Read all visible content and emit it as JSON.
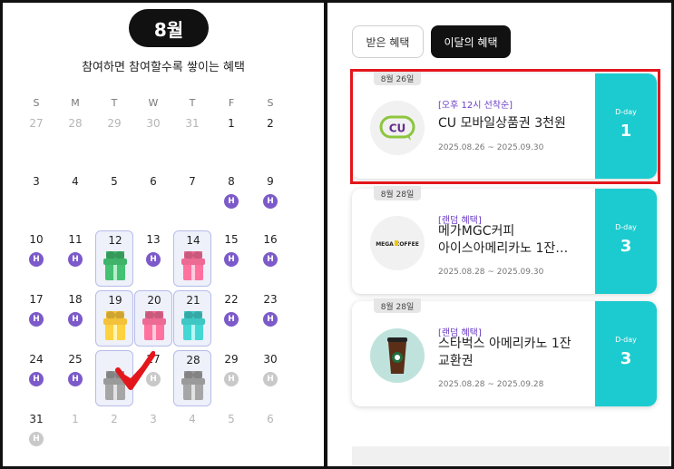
{
  "calendar": {
    "month": "8월",
    "subtitle": "참여하면 참여할수록 쌓이는 혜택",
    "weekdays": [
      "S",
      "M",
      "T",
      "W",
      "T",
      "F",
      "S"
    ],
    "badge_label": "H",
    "days": [
      {
        "n": "27",
        "other": true
      },
      {
        "n": "28",
        "other": true
      },
      {
        "n": "29",
        "other": true
      },
      {
        "n": "30",
        "other": true
      },
      {
        "n": "31",
        "other": true
      },
      {
        "n": "1"
      },
      {
        "n": "2"
      },
      {
        "n": "3"
      },
      {
        "n": "4"
      },
      {
        "n": "5"
      },
      {
        "n": "6"
      },
      {
        "n": "7"
      },
      {
        "n": "8",
        "badge": "purple"
      },
      {
        "n": "9",
        "badge": "purple"
      },
      {
        "n": "10",
        "badge": "purple"
      },
      {
        "n": "11",
        "badge": "purple"
      },
      {
        "n": "12",
        "gift": "green",
        "boxed": true
      },
      {
        "n": "13",
        "badge": "purple"
      },
      {
        "n": "14",
        "gift": "pink",
        "boxed": true
      },
      {
        "n": "15",
        "badge": "purple"
      },
      {
        "n": "16",
        "badge": "purple"
      },
      {
        "n": "17",
        "badge": "purple"
      },
      {
        "n": "18",
        "badge": "purple"
      },
      {
        "n": "19",
        "gift": "yellow",
        "boxed": true
      },
      {
        "n": "20",
        "gift": "pink",
        "boxed": true
      },
      {
        "n": "21",
        "gift": "teal",
        "boxed": true
      },
      {
        "n": "22",
        "badge": "purple"
      },
      {
        "n": "23",
        "badge": "purple"
      },
      {
        "n": "24",
        "badge": "purple"
      },
      {
        "n": "25",
        "badge": "purple"
      },
      {
        "n": "",
        "gift": "gray",
        "boxed": true,
        "checked": true
      },
      {
        "n": "27",
        "badge": "gray"
      },
      {
        "n": "28",
        "gift": "gray",
        "boxed": true
      },
      {
        "n": "29",
        "badge": "gray"
      },
      {
        "n": "30",
        "badge": "gray"
      },
      {
        "n": "31",
        "badge": "gray"
      },
      {
        "n": "1",
        "other": true
      },
      {
        "n": "2",
        "other": true
      },
      {
        "n": "3",
        "other": true
      },
      {
        "n": "4",
        "other": true
      },
      {
        "n": "5",
        "other": true
      },
      {
        "n": "6",
        "other": true
      }
    ],
    "colors": {
      "purple": "#7c5ac9",
      "gift_green": "#3fb36a",
      "gift_pink": "#ec6a93",
      "gift_yellow": "#f3c23a",
      "gift_teal": "#3fc7c4",
      "gift_gray": "#9a9a9a",
      "check": "#e3161c"
    }
  },
  "benefits": {
    "tabs": [
      {
        "label": "받은 혜택",
        "active": false
      },
      {
        "label": "이달의 혜택",
        "active": true
      }
    ],
    "cards": [
      {
        "date": "8월 26일",
        "tag": "[오후 12시 선착순]",
        "title_lines": [
          "CU 모바일상품권 3천원"
        ],
        "period": "2025.08.26 ~ 2025.09.30",
        "dday_label": "D-day",
        "dday_value": "1",
        "logo": "cu-logo",
        "logo_text": "CU",
        "highlighted": true
      },
      {
        "date": "8월 28일",
        "tag": "[랜덤 혜택]",
        "title_lines": [
          "메가MGC커피",
          "아이스아메리카노 1잔…"
        ],
        "period": "2025.08.28 ~ 2025.09.30",
        "dday_label": "D-day",
        "dday_value": "3",
        "logo": "mega-coffee-logo",
        "logo_text": "MEGA COFFEE"
      },
      {
        "date": "8월 28일",
        "tag": "[랜덤 혜택]",
        "title_lines": [
          "스타벅스 아메리카노 1잔",
          "교환권"
        ],
        "period": "2025.08.28 ~ 2025.09.28",
        "dday_label": "D-day",
        "dday_value": "3",
        "logo": "starbucks-cup-image"
      }
    ],
    "colors": {
      "stub": "#1ccbcf",
      "tag": "#6a3ec6",
      "highlight": "#e3161c"
    }
  }
}
